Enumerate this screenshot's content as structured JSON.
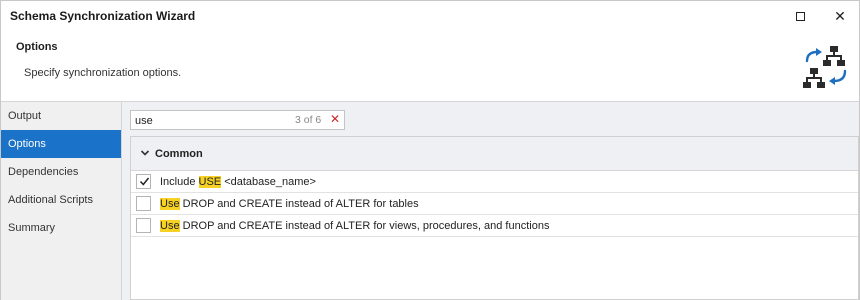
{
  "window": {
    "title": "Schema Synchronization Wizard"
  },
  "header": {
    "title": "Options",
    "description": "Specify synchronization options."
  },
  "sidebar": {
    "items": [
      {
        "label": "Output",
        "active": false
      },
      {
        "label": "Options",
        "active": true
      },
      {
        "label": "Dependencies",
        "active": false
      },
      {
        "label": "Additional Scripts",
        "active": false
      },
      {
        "label": "Summary",
        "active": false
      }
    ]
  },
  "search": {
    "value": "use",
    "match_count": "3 of 6"
  },
  "group": {
    "title": "Common"
  },
  "options": [
    {
      "before": "Include ",
      "highlight": "USE",
      "after": " <database_name>",
      "checked": true
    },
    {
      "before": "",
      "highlight": "Use",
      "after": " DROP and CREATE instead of ALTER for tables",
      "checked": false
    },
    {
      "before": "",
      "highlight": "Use",
      "after": " DROP and CREATE instead of ALTER for views, procedures, and functions",
      "checked": false
    }
  ],
  "colors": {
    "accent": "#1a73c8",
    "highlight": "#f7d224",
    "icon_blue": "#1e6fc0",
    "icon_dark": "#2b2b2b"
  }
}
